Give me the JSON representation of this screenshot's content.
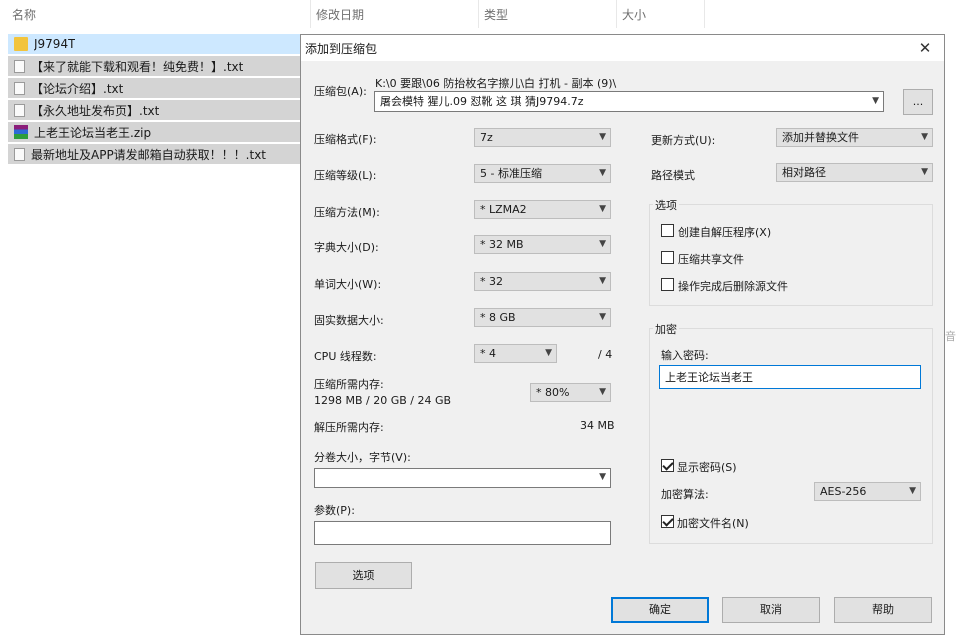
{
  "explorer": {
    "columns": {
      "name": "名称",
      "modified": "修改日期",
      "type": "类型",
      "size": "大小"
    },
    "files": [
      {
        "name": "J9794T",
        "icon": "folder-icon"
      },
      {
        "name": "【来了就能下载和观看！纯免费！】.txt",
        "icon": "txt-icon"
      },
      {
        "name": "【论坛介绍】.txt",
        "icon": "txt-icon"
      },
      {
        "name": "【永久地址发布页】.txt",
        "icon": "txt-icon"
      },
      {
        "name": "上老王论坛当老王.zip",
        "icon": "zip-icon"
      },
      {
        "name": "最新地址及APP请发邮箱自动获取！！！.txt",
        "icon": "txt-icon"
      }
    ],
    "stray_text": "音"
  },
  "dialog": {
    "title": "添加到压缩包",
    "close_glyph": "✕",
    "archive": {
      "label": "压缩包(A):",
      "path": "K:\\0 要跟\\06 防抬枚名字擦儿\\白 打机 - 副本 (9)\\",
      "filename": "屠会模特 猩儿.09 怼靴 这 琪 猜J9794.7z",
      "browse_label": "..."
    },
    "left": {
      "format": {
        "label": "压缩格式(F):",
        "value": "7z"
      },
      "level": {
        "label": "压缩等级(L):",
        "value": "5 - 标准压缩"
      },
      "method": {
        "label": "压缩方法(M):",
        "value": "* LZMA2"
      },
      "dict": {
        "label": "字典大小(D):",
        "value": "* 32 MB"
      },
      "word": {
        "label": "单词大小(W):",
        "value": "* 32"
      },
      "solid": {
        "label": "固实数据大小:",
        "value": "* 8 GB"
      },
      "cpu": {
        "label": "CPU 线程数:",
        "value": "* 4",
        "total": "/ 4"
      },
      "mem_compress": {
        "label": "压缩所需内存:",
        "detail": "1298 MB / 20 GB / 24 GB",
        "percent": "* 80%"
      },
      "mem_decompress": {
        "label": "解压所需内存:",
        "value": "34 MB"
      },
      "split": {
        "label": "分卷大小，字节(V):",
        "value": ""
      },
      "params": {
        "label": "参数(P):",
        "value": ""
      },
      "options_button": "选项"
    },
    "right": {
      "update": {
        "label": "更新方式(U):",
        "value": "添加并替换文件"
      },
      "path_mode": {
        "label": "路径模式",
        "value": "相对路径"
      },
      "options_group": {
        "title": "选项",
        "items": [
          {
            "label": "创建自解压程序(X)",
            "checked": false
          },
          {
            "label": "压缩共享文件",
            "checked": false
          },
          {
            "label": "操作完成后删除源文件",
            "checked": false
          }
        ]
      },
      "encryption": {
        "title": "加密",
        "password_label": "输入密码:",
        "password": "上老王论坛当老王",
        "show_password": {
          "label": "显示密码(S)",
          "checked": true
        },
        "method_label": "加密算法:",
        "method_value": "AES-256",
        "encrypt_names": {
          "label": "加密文件名(N)",
          "checked": true
        }
      }
    },
    "buttons": {
      "ok": "确定",
      "cancel": "取消",
      "help": "帮助"
    }
  }
}
